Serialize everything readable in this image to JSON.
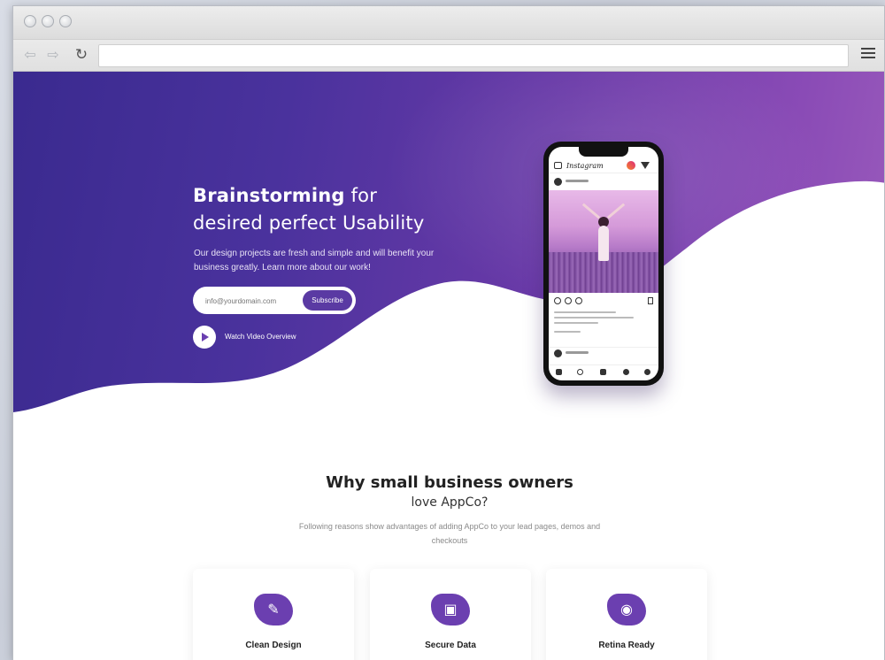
{
  "browser": {
    "back_icon": "⇦",
    "forward_icon": "⇨",
    "reload_icon": "↻",
    "url": ""
  },
  "hero": {
    "title_bold": "Brainstorming",
    "title_rest": " for",
    "title_line2": "desired perfect Usability",
    "description": "Our design projects are fresh and simple and will benefit your business greatly. Learn more about our work!",
    "email_placeholder": "info@yourdomain.com",
    "subscribe_label": "Subscribe",
    "video_label": "Watch Video Overview"
  },
  "phone": {
    "app_name": "Instagram"
  },
  "features": {
    "title": "Why small business owners",
    "title_line2": "love AppCo?",
    "description": "Following reasons show advantages of adding AppCo to your lead pages, demos and checkouts",
    "cards": [
      {
        "title": "Clean Design",
        "icon": "pen-tool-icon",
        "glyph": "✎"
      },
      {
        "title": "Secure Data",
        "icon": "lock-icon",
        "glyph": "▣"
      },
      {
        "title": "Retina Ready",
        "icon": "eye-icon",
        "glyph": "◉"
      }
    ]
  },
  "colors": {
    "hero_gradient_start": "#3a2a8f",
    "hero_gradient_end": "#9b5cbc",
    "accent": "#6b3fb0"
  }
}
